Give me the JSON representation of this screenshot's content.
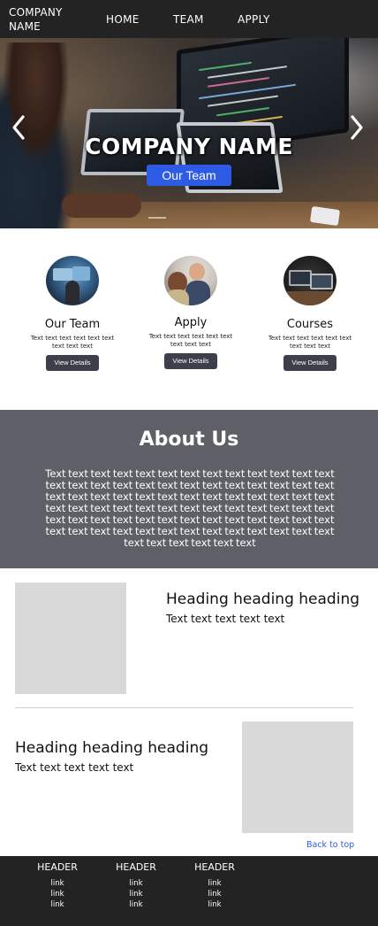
{
  "nav": {
    "brand": "COMPANY NAME",
    "links": [
      "HOME",
      "TEAM",
      "APPLY"
    ]
  },
  "hero": {
    "title": "COMPANY NAME",
    "button": "Our Team",
    "prev_icon": "chevron-left-icon",
    "next_icon": "chevron-right-icon"
  },
  "cards": [
    {
      "title": "Our Team",
      "text": "Text text text text text text text text text",
      "button": "View Details"
    },
    {
      "title": "Apply",
      "text": "Text text text text text text text text text",
      "button": "View Details"
    },
    {
      "title": "Courses",
      "text": "Text text text text text text text text text",
      "button": "View Details"
    }
  ],
  "about": {
    "title": "About Us",
    "text": "Text text text text text text text text text text text text text text text text text text text text text text text text text text text text text text text text text text text text text text text text text text text text text text text text text text text text text text text text text text text text text text text text text text text text text text text text text text text text text text text text text text text text"
  },
  "features": [
    {
      "heading": "Heading heading heading",
      "text": "Text text text text text"
    },
    {
      "heading": "Heading heading heading",
      "text": "Text text text text text"
    }
  ],
  "back_to_top": "Back to top",
  "footer": {
    "columns": [
      {
        "header": "HEADER",
        "links": [
          "link",
          "link",
          "link"
        ]
      },
      {
        "header": "HEADER",
        "links": [
          "link",
          "link",
          "link"
        ]
      },
      {
        "header": "HEADER",
        "links": [
          "link",
          "link",
          "link"
        ]
      }
    ]
  },
  "colors": {
    "nav_bg": "#232323",
    "accent_blue": "#2d5be3",
    "about_bg": "#5f6067",
    "card_button": "#3d3f4b",
    "placeholder": "#d9d9d9"
  }
}
